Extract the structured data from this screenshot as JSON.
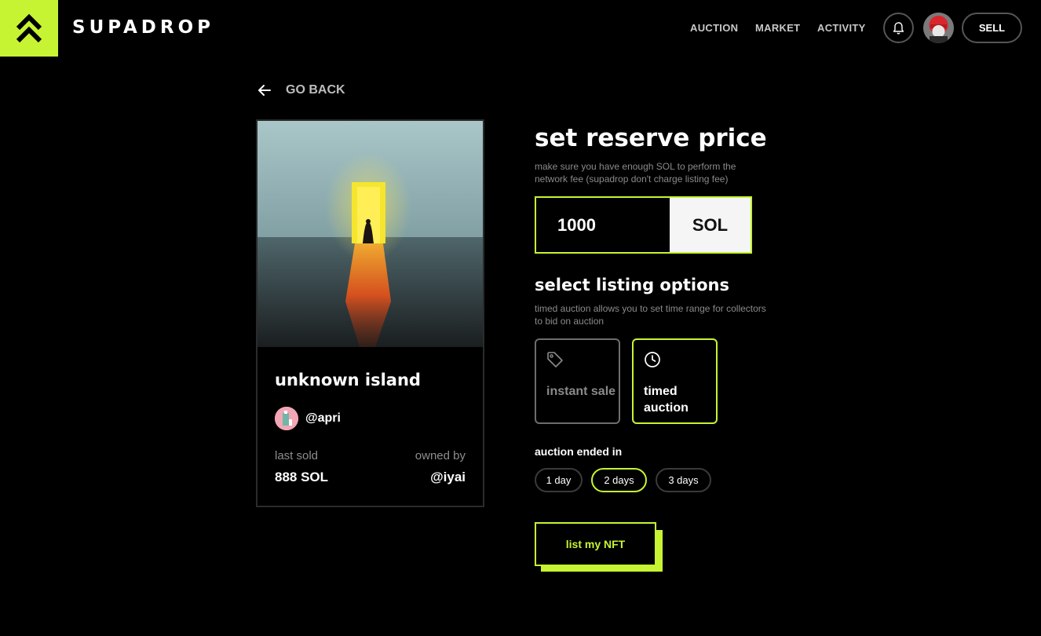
{
  "header": {
    "brand": "SUPADROP",
    "nav": [
      "AUCTION",
      "MARKET",
      "ACTIVITY"
    ],
    "sell_label": "SELL"
  },
  "go_back": "GO BACK",
  "nft": {
    "title": "unknown island",
    "creator": "@apri",
    "last_sold_label": "last sold",
    "last_sold_value": "888 SOL",
    "owned_by_label": "owned by",
    "owned_by_value": "@iyai"
  },
  "reserve": {
    "heading": "set reserve price",
    "note": "make sure you have enough SOL to perform the network fee (supadrop don't charge listing fee)",
    "price": "1000",
    "unit": "SOL"
  },
  "listing": {
    "heading": "select listing options",
    "note": "timed auction allows you to set time range for collectors to bid on auction",
    "options": [
      {
        "label": "instant sale",
        "icon": "tag-icon",
        "selected": false
      },
      {
        "label": "timed auction",
        "icon": "clock-icon",
        "selected": true
      }
    ]
  },
  "auction": {
    "ended_label": "auction ended in",
    "durations": [
      "1 day",
      "2 days",
      "3 days"
    ],
    "selected_duration": "2 days"
  },
  "submit_label": "list my NFT",
  "colors": {
    "accent": "#c6f432",
    "background": "#000000"
  }
}
